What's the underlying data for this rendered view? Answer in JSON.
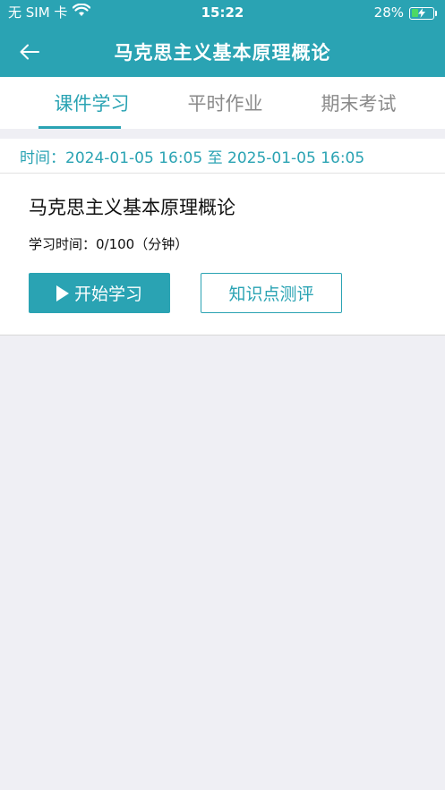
{
  "status_bar": {
    "carrier": "无 SIM 卡",
    "time": "15:22",
    "battery_percent": "28%",
    "battery_level": 0.28,
    "charging": true
  },
  "header": {
    "title": "马克思主义基本原理概论",
    "back_icon": "arrow-left-icon"
  },
  "tabs": [
    {
      "label": "课件学习",
      "active": true
    },
    {
      "label": "平时作业",
      "active": false
    },
    {
      "label": "期末考试",
      "active": false
    }
  ],
  "time_range": "时间：2024-01-05 16:05 至 2025-01-05 16:05",
  "course": {
    "title": "马克思主义基本原理概论",
    "study_time": "学习时间：0/100（分钟）",
    "start_button": "开始学习",
    "assess_button": "知识点测评"
  },
  "colors": {
    "accent": "#2aa3b3",
    "background": "#efeff4"
  }
}
